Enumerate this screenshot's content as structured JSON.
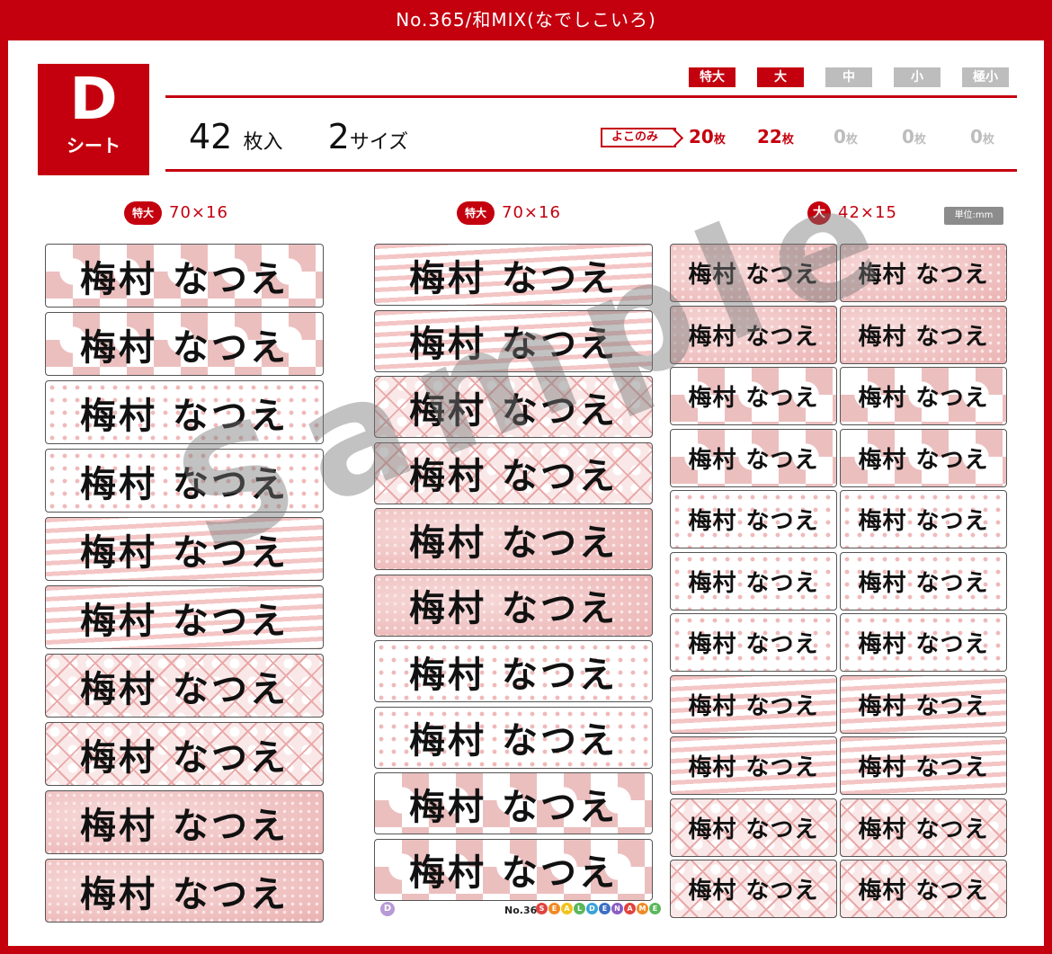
{
  "header": {
    "title": "No.365/和MIX(なでしこいろ)"
  },
  "sheet": {
    "letter": "D",
    "label": "シート"
  },
  "summary": {
    "count": "42",
    "count_unit": "枚入",
    "sizes": "2",
    "sizes_unit": "サイズ"
  },
  "size_tabs": [
    {
      "label": "特大",
      "active": true
    },
    {
      "label": "大",
      "active": true
    },
    {
      "label": "中",
      "active": false
    },
    {
      "label": "小",
      "active": false
    },
    {
      "label": "極小",
      "active": false
    }
  ],
  "orientation_badge": "よこのみ",
  "counts": [
    {
      "num": "20",
      "unit": "枚",
      "active": true
    },
    {
      "num": "22",
      "unit": "枚",
      "active": true
    },
    {
      "num": "0",
      "unit": "枚",
      "active": false
    },
    {
      "num": "0",
      "unit": "枚",
      "active": false
    },
    {
      "num": "0",
      "unit": "枚",
      "active": false
    }
  ],
  "columns": [
    {
      "badge": "特大",
      "dims": "70×16"
    },
    {
      "badge": "特大",
      "dims": "70×16"
    },
    {
      "badge": "大",
      "dims": "42×15"
    }
  ],
  "unit_note": "単位:mm",
  "label_text": "梅村 なつえ",
  "watermark": "Sample",
  "footer": {
    "sheet_mark": "D",
    "number": "No.365",
    "brand": "SEALDENAME"
  },
  "colors": {
    "accent": "#c4000e",
    "inactive": "#bdbdbd",
    "pattern_pink": "#ecbfbf"
  }
}
